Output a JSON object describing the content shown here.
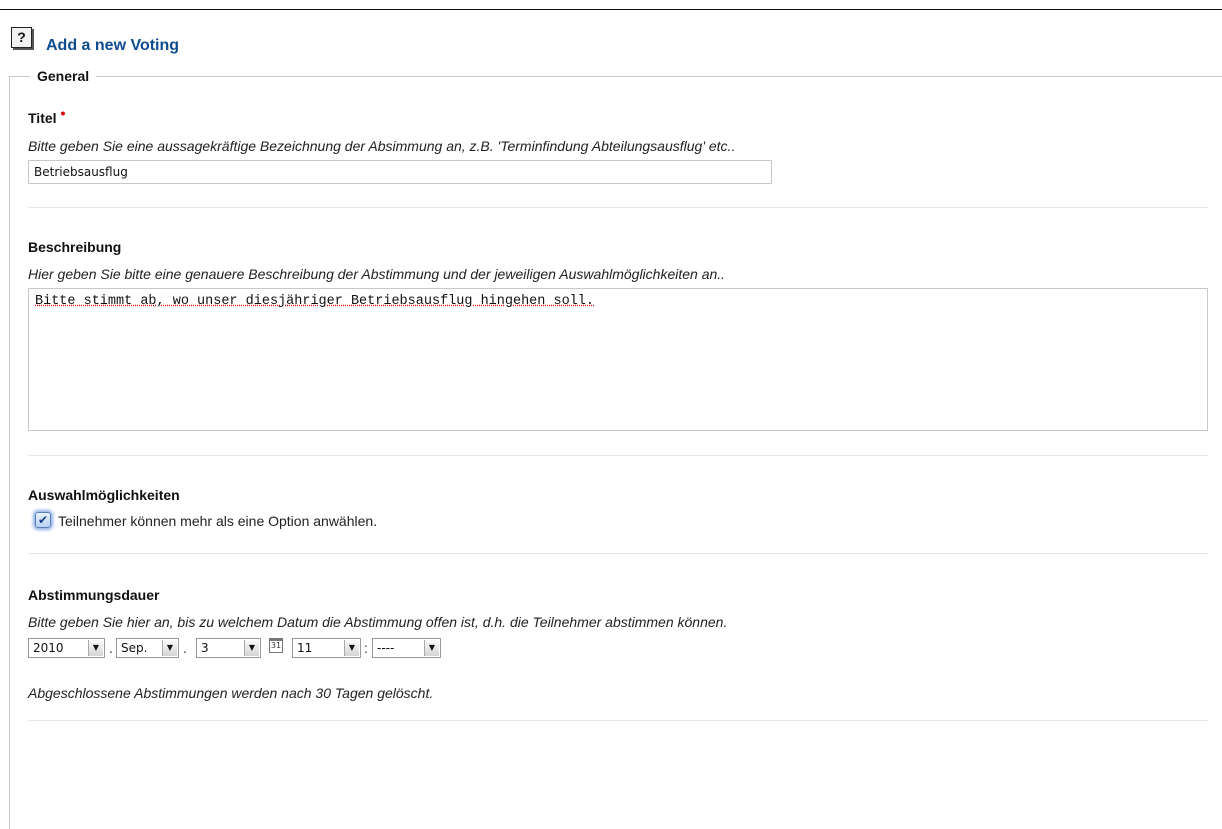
{
  "header": {
    "help_icon_glyph": "?",
    "title": "Add a new Voting"
  },
  "general": {
    "legend": "General"
  },
  "titel": {
    "label": "Titel",
    "required_mark": "•",
    "hint": "Bitte geben Sie eine aussagekräftige Bezeichnung der Absimmung an, z.B. 'Terminfindung Abteilungsausflug' etc..",
    "value": "Betriebsausflug"
  },
  "beschreibung": {
    "label": "Beschreibung",
    "hint": "Hier geben Sie bitte eine genauere Beschreibung der Abstimmung und der jeweiligen Auswahlmöglichkeiten an..",
    "value": "Bitte stimmt ab, wo unser diesjähriger Betriebsausflug hingehen soll."
  },
  "auswahl": {
    "label": "Auswahlmöglichkeiten",
    "checkbox_checked": true,
    "checkbox_label": "Teilnehmer können mehr als eine Option anwählen."
  },
  "dauer": {
    "label": "Abstimmungsdauer",
    "hint": "Bitte geben Sie hier an, bis zu welchem Datum die Abstimmung offen ist, d.h. die Teilnehmer abstimmen können.",
    "year": "2010",
    "month": "Sep.",
    "day": "3",
    "hour": "11",
    "minute": "----",
    "date_sep": ".",
    "time_sep": ":",
    "calendar_icon_text": "31",
    "note": "Abgeschlossene Abstimmungen werden nach 30 Tagen gelöscht."
  },
  "icons": {
    "help": "help-icon",
    "calendar": "calendar-icon",
    "dropdown": "chevron-down-icon"
  }
}
